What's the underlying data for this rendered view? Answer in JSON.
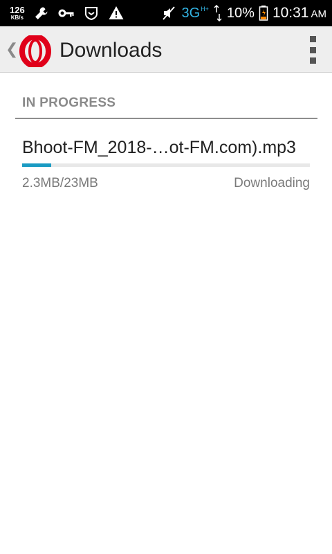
{
  "status_bar": {
    "net_speed_value": "126",
    "net_speed_unit": "KB/s",
    "network_type": "3G",
    "network_sub": "H+",
    "battery_percent": "10%",
    "time": "10:31",
    "ampm": "AM",
    "icons": [
      "wrench-icon",
      "key-icon",
      "shield-icon",
      "warning-icon",
      "mute-icon",
      "signal-icon",
      "battery-icon"
    ]
  },
  "action_bar": {
    "title": "Downloads",
    "logo": "opera-logo",
    "colors": {
      "logo_red": "#e0001a"
    }
  },
  "section": {
    "header": "IN PROGRESS"
  },
  "downloads": [
    {
      "file_name": "Bhoot-FM_2018-…ot-FM.com).mp3",
      "size_text": "2.3MB/23MB",
      "status": "Downloading",
      "progress": 0.1
    }
  ],
  "colors": {
    "progress_fill": "#1a9bc3",
    "network_blue": "#33b5e5"
  }
}
